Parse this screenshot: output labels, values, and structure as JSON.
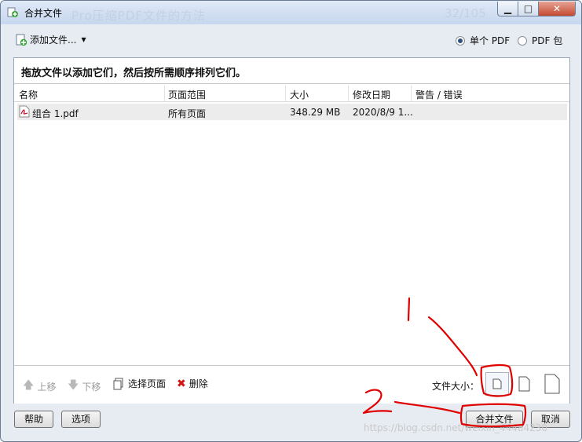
{
  "window": {
    "title": "合并文件",
    "background_title": "Pro压缩PDF文件的方法",
    "background_number": "32/105"
  },
  "toolbar": {
    "add_files_label": "添加文件...",
    "output_options": [
      {
        "label": "单个 PDF",
        "selected": true
      },
      {
        "label": "PDF 包",
        "selected": false
      }
    ]
  },
  "panel": {
    "instruction": "拖放文件以添加它们，然后按所需顺序排列它们。",
    "columns": [
      "名称",
      "页面范围",
      "大小",
      "修改日期",
      "警告 / 错误"
    ],
    "rows": [
      {
        "name": "组合 1.pdf",
        "page_range": "所有页面",
        "size": "348.29 MB",
        "modified": "2020/8/9 1...",
        "warning": ""
      }
    ]
  },
  "bottom_toolbar": {
    "move_up": "上移",
    "move_down": "下移",
    "choose_pages": "选择页面",
    "delete": "删除",
    "file_size_label": "文件大小："
  },
  "footer": {
    "help": "帮助",
    "options": "选项",
    "merge": "合并文件",
    "cancel": "取消"
  },
  "watermark": "https://blog.csdn.net/weixin_44484230",
  "annotations": {
    "mark_1": "1",
    "mark_2": "2",
    "color": "#e10000"
  },
  "icons": {
    "title": "merge-files-icon",
    "add": "add-file-icon",
    "pdf": "pdf-file-icon",
    "up": "arrow-up-icon",
    "down": "arrow-down-icon",
    "pages": "pages-icon",
    "delete": "red-x-icon"
  }
}
